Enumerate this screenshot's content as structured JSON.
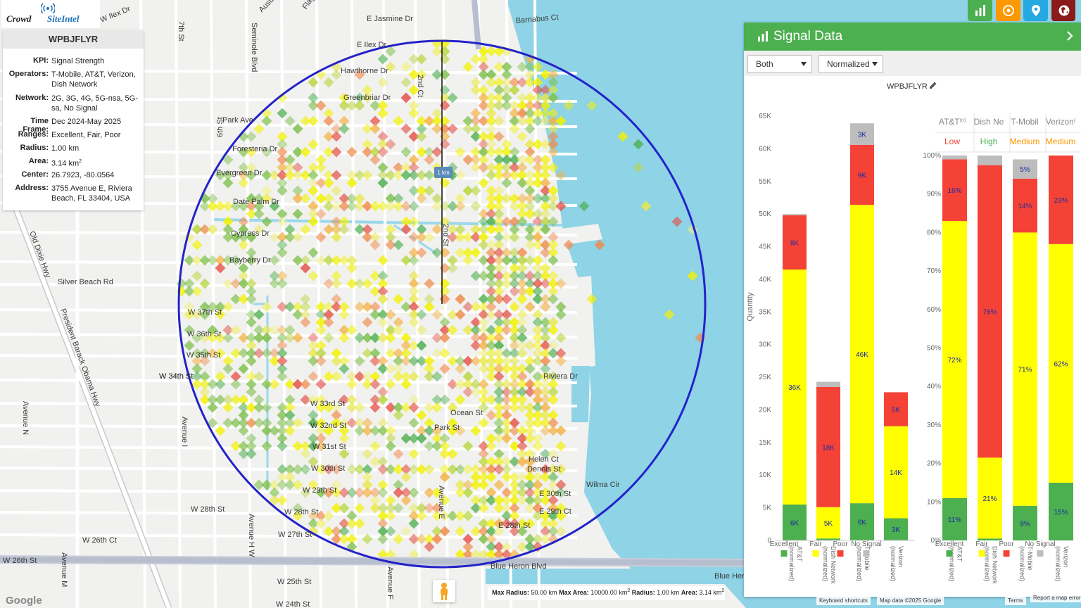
{
  "logo": {
    "text_crowd": "Crowd",
    "text_site": "SiteIntel"
  },
  "info": {
    "title": "WPBJFLYR",
    "rows": [
      {
        "k": "KPI:",
        "v": "Signal Strength"
      },
      {
        "k": "Operators:",
        "v": "T-Mobile, AT&T, Verizon, Dish Network"
      },
      {
        "k": "Network:",
        "v": "2G, 3G, 4G, 5G-nsa, 5G-sa, No Signal"
      },
      {
        "k": "Time Frame:",
        "v": "Dec 2024-May 2025"
      },
      {
        "k": "Ranges:",
        "v": "Excellent, Fair, Poor"
      },
      {
        "k": "Radius:",
        "v": "1.00 km"
      },
      {
        "k": "Area:",
        "v": "3.14 km",
        "sup": "2"
      },
      {
        "k": "Center:",
        "v": "26.7923, -80.0564"
      },
      {
        "k": "Address:",
        "v": "3755 Avenue E, Riviera Beach, FL 33404, USA"
      }
    ]
  },
  "top_buttons": [
    {
      "name": "chart-button",
      "icon": "bar-chart-icon",
      "color": "#4caf50"
    },
    {
      "name": "target-button",
      "icon": "target-icon",
      "color": "#ff9800"
    },
    {
      "name": "location-button",
      "icon": "map-pin-icon",
      "color": "#26a9e0"
    },
    {
      "name": "globe-button",
      "icon": "globe-icon",
      "color": "#8b1a1a"
    }
  ],
  "map": {
    "radius_label": "1 km",
    "streets": [
      {
        "t": "E Jasmine Dr"
      },
      {
        "t": "Barnabus Ct"
      },
      {
        "t": "E Ilex Dr"
      },
      {
        "t": "W Ilex Dr"
      },
      {
        "t": "Hawthorne Dr"
      },
      {
        "t": "Greenbriar Dr"
      },
      {
        "t": "Park Ave"
      },
      {
        "t": "Foresteria Dr"
      },
      {
        "t": "Evergreen Dr"
      },
      {
        "t": "Date Palm Dr"
      },
      {
        "t": "Cypress Dr"
      },
      {
        "t": "Bayberry Dr"
      },
      {
        "t": "Silver Beach Rd"
      },
      {
        "t": "W 37th St"
      },
      {
        "t": "W 36th St"
      },
      {
        "t": "W 35th St"
      },
      {
        "t": "W 34th St"
      },
      {
        "t": "W 33rd St"
      },
      {
        "t": "W 32nd St"
      },
      {
        "t": "W 31st St"
      },
      {
        "t": "W 30th St"
      },
      {
        "t": "W 29th St"
      },
      {
        "t": "W 28th St"
      },
      {
        "t": "W 27th St"
      },
      {
        "t": "W 26th Ct"
      },
      {
        "t": "W 26th St"
      },
      {
        "t": "W 25th St"
      },
      {
        "t": "W 24th St"
      },
      {
        "t": "Blue Heron Blvd"
      },
      {
        "t": "Riviera Dr"
      },
      {
        "t": "Ocean St"
      },
      {
        "t": "Park St"
      },
      {
        "t": "Helen Ct"
      },
      {
        "t": "Dennis St"
      },
      {
        "t": "Wilma Cir"
      },
      {
        "t": "E 30th St"
      },
      {
        "t": "E 29th Ct"
      },
      {
        "t": "E 28th St"
      },
      {
        "t": "Avenue E"
      },
      {
        "t": "President Barack Obama Hwy"
      },
      {
        "t": "Old Dixie Hwy"
      },
      {
        "t": "W 34th St"
      },
      {
        "t": "W 28th St"
      },
      {
        "t": "Avenue N"
      },
      {
        "t": "Avenue M"
      },
      {
        "t": "Avenue I"
      },
      {
        "t": "Avenue H W"
      },
      {
        "t": "Avenue F"
      },
      {
        "t": "Flagler Blvd"
      },
      {
        "t": "Australian Cir"
      },
      {
        "t": "Seminole Blvd"
      },
      {
        "t": "7th St"
      },
      {
        "t": "6th St"
      },
      {
        "t": "2nd Ct"
      },
      {
        "t": "2nd St"
      },
      {
        "t": "Blue Heron"
      }
    ]
  },
  "panel": {
    "title": "Signal Data",
    "select_operator": "Both",
    "select_mode": "Normalized",
    "chart_title": "WPBJFLYR"
  },
  "footer": {
    "max_radius_label": "Max Radius:",
    "max_radius": "50.00 km",
    "max_area_label": "Max Area:",
    "max_area": "10000.00 km",
    "radius_label": "Radius:",
    "radius": "1.00 km",
    "area_label": "Area:",
    "area": "3.14 km",
    "keyboard": "Keyboard shortcuts",
    "mapdata": "Map data ©2025 Google",
    "terms": "Terms",
    "report": "Report a map error",
    "google": "Google"
  },
  "chart_data": [
    {
      "type": "bar",
      "stacked": true,
      "title": "WPBJFLYR",
      "ylabel": "Quantity",
      "ylim": [
        0,
        65000
      ],
      "yticks": [
        "0",
        "5K",
        "10K",
        "15K",
        "20K",
        "25K",
        "30K",
        "35K",
        "40K",
        "45K",
        "50K",
        "55K",
        "60K",
        "65K"
      ],
      "categories": [
        "AT&T (normalized)",
        "Dish Network (normalized)",
        "T-Mobile (normalized)",
        "Verizon (normalized)"
      ],
      "series": [
        {
          "name": "Excellent",
          "color": "#4caf50",
          "values": [
            5500,
            300,
            5700,
            3400
          ],
          "labels": [
            "6K",
            "",
            "6K",
            "3K"
          ]
        },
        {
          "name": "Fair",
          "color": "#ffff00",
          "values": [
            36000,
            4800,
            45700,
            14100
          ],
          "labels": [
            "36K",
            "5K",
            "46K",
            "14K"
          ]
        },
        {
          "name": "Poor",
          "color": "#f44336",
          "values": [
            8300,
            18400,
            9200,
            5200
          ],
          "labels": [
            "8K",
            "18K",
            "9K",
            "5K"
          ]
        },
        {
          "name": "No Signal",
          "color": "#bdbdbd",
          "values": [
            200,
            800,
            3300,
            0
          ],
          "labels": [
            "",
            "",
            "3K",
            ""
          ]
        }
      ]
    },
    {
      "type": "bar",
      "stacked": true,
      "percent": true,
      "ylim": [
        0,
        100
      ],
      "yticks": [
        "0%",
        "10%",
        "20%",
        "30%",
        "40%",
        "50%",
        "60%",
        "70%",
        "80%",
        "90%",
        "100%"
      ],
      "categories": [
        "AT&T (normalized)",
        "Dish Network (normalized)",
        "T-Mobile (normalized)",
        "Verizon (normalized)"
      ],
      "column_headers": [
        "AT&T",
        "Dish Ne",
        "T-Mobil",
        "Verizon"
      ],
      "header_sup": [
        "(n)",
        "",
        "",
        "("
      ],
      "ratings": [
        {
          "text": "Low",
          "color": "#f44336"
        },
        {
          "text": "High",
          "color": "#4caf50"
        },
        {
          "text": "Medium",
          "color": "#ff9800"
        },
        {
          "text": "Medium",
          "color": "#ff9800"
        }
      ],
      "series": [
        {
          "name": "Excellent",
          "color": "#4caf50",
          "values": [
            11,
            0.5,
            9,
            15
          ],
          "labels": [
            "11%",
            "",
            "9%",
            "15%"
          ]
        },
        {
          "name": "Fair",
          "color": "#ffff00",
          "values": [
            72,
            21,
            71,
            62
          ],
          "labels": [
            "72%",
            "21%",
            "71%",
            "62%"
          ]
        },
        {
          "name": "Poor",
          "color": "#f44336",
          "values": [
            16,
            76,
            14,
            23
          ],
          "labels": [
            "16%",
            "76%",
            "14%",
            "23%"
          ]
        },
        {
          "name": "No Signal",
          "color": "#bdbdbd",
          "values": [
            1,
            2.5,
            5,
            0
          ],
          "labels": [
            "",
            "",
            "5%",
            ""
          ]
        }
      ]
    }
  ]
}
